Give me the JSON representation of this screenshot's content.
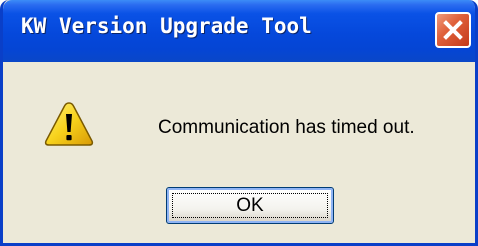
{
  "window": {
    "title": "KW Version Upgrade Tool",
    "close_icon": "close-icon"
  },
  "dialog": {
    "icon": "warning-icon",
    "message": "Communication has timed out.",
    "ok_label": "OK"
  },
  "colors": {
    "titlebar": "#0548db",
    "close_button": "#e0623c",
    "dialog_background": "#ece9d8",
    "warning_yellow": "#f7d21c"
  }
}
